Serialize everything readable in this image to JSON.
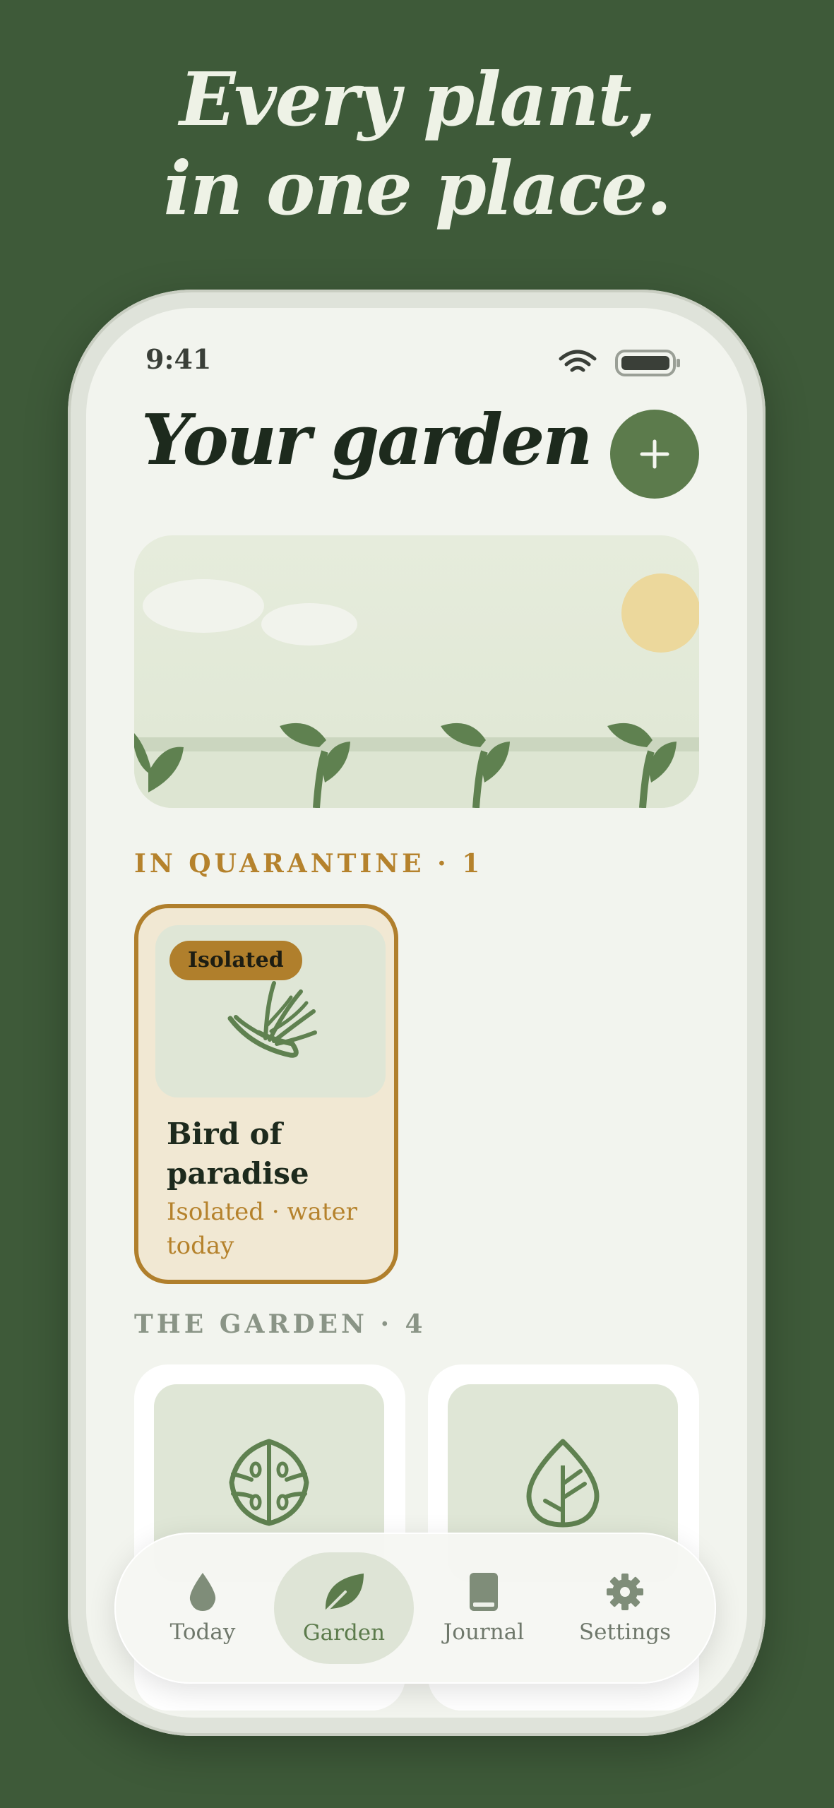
{
  "marketing": {
    "headline_line1": "Every plant,",
    "headline_line2": "in one place."
  },
  "status_bar": {
    "time": "9:41",
    "icons": [
      "wifi-icon",
      "battery-icon"
    ]
  },
  "header": {
    "title": "Your garden",
    "add_button": "+"
  },
  "sections": {
    "quarantine": {
      "label": "IN QUARANTINE · 1"
    },
    "garden": {
      "label": "THE GARDEN · 4"
    }
  },
  "quarantine_cards": [
    {
      "badge": "Isolated",
      "name": "Bird of paradise",
      "status": "Isolated · water today",
      "icon": "bird-of-paradise-icon"
    }
  ],
  "garden_cards": [
    {
      "icon": "monstera-leaf-icon"
    },
    {
      "icon": "drop-leaf-icon"
    }
  ],
  "tabbar": {
    "tabs": [
      {
        "label": "Today",
        "icon": "water-drop-icon",
        "active": false
      },
      {
        "label": "Garden",
        "icon": "leaf-icon",
        "active": true
      },
      {
        "label": "Journal",
        "icon": "journal-icon",
        "active": false
      },
      {
        "label": "Settings",
        "icon": "gear-icon",
        "active": false
      }
    ]
  },
  "colors": {
    "background": "#3e5a39",
    "accent_green": "#5c7b4c",
    "quarantine_amber": "#b07f2c",
    "screen": "#f2f4ee"
  }
}
